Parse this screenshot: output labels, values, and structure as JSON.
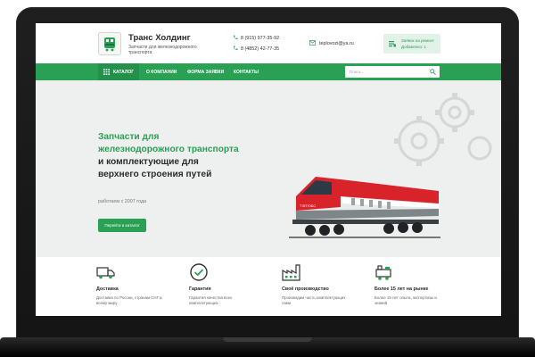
{
  "header": {
    "brand_name": "Транс Холдинг",
    "brand_sub": "Запчасти для железнодорожного транспорта",
    "phone1": "8 (915) 977-35-92",
    "phone2": "8 (4852) 42-77-35",
    "email": "teplovozi@ya.ru",
    "cart_line1": "Заявок на ремонт",
    "cart_line2": "Добавлено: 1"
  },
  "nav": {
    "catalog": "КАТАЛОГ",
    "items": [
      "О КОМПАНИИ",
      "ФОРМА ЗАЯВКИ",
      "КОНТАКТЫ"
    ],
    "search_placeholder": "Поиск..."
  },
  "hero": {
    "line1": "Запчасти для",
    "line2": "железнодорожного транспорта",
    "line3": "и комплектующие для",
    "line4": "верхнего строения путей",
    "since": "работаем с 2007 года",
    "cta": "Перейти в каталог"
  },
  "features": [
    {
      "icon": "truck-icon",
      "title": "Доставка",
      "desc": "Доставка по России, странам СНГ и всему миру"
    },
    {
      "icon": "check-circle-icon",
      "title": "Гарантия",
      "desc": "Гарантия качества всех комплектующих"
    },
    {
      "icon": "factory-icon",
      "title": "Своё производство",
      "desc": "Производим часть комплектующих сами"
    },
    {
      "icon": "locomotive-icon",
      "title": "Более 15 лет на рынке",
      "desc": "Более 15 лет опыта, экспертизы и знаний"
    }
  ],
  "colors": {
    "accent": "#2aa055",
    "accent_dark": "#23904b",
    "hero_bg": "#eef0ef",
    "laptop": "#1a1a1a"
  }
}
